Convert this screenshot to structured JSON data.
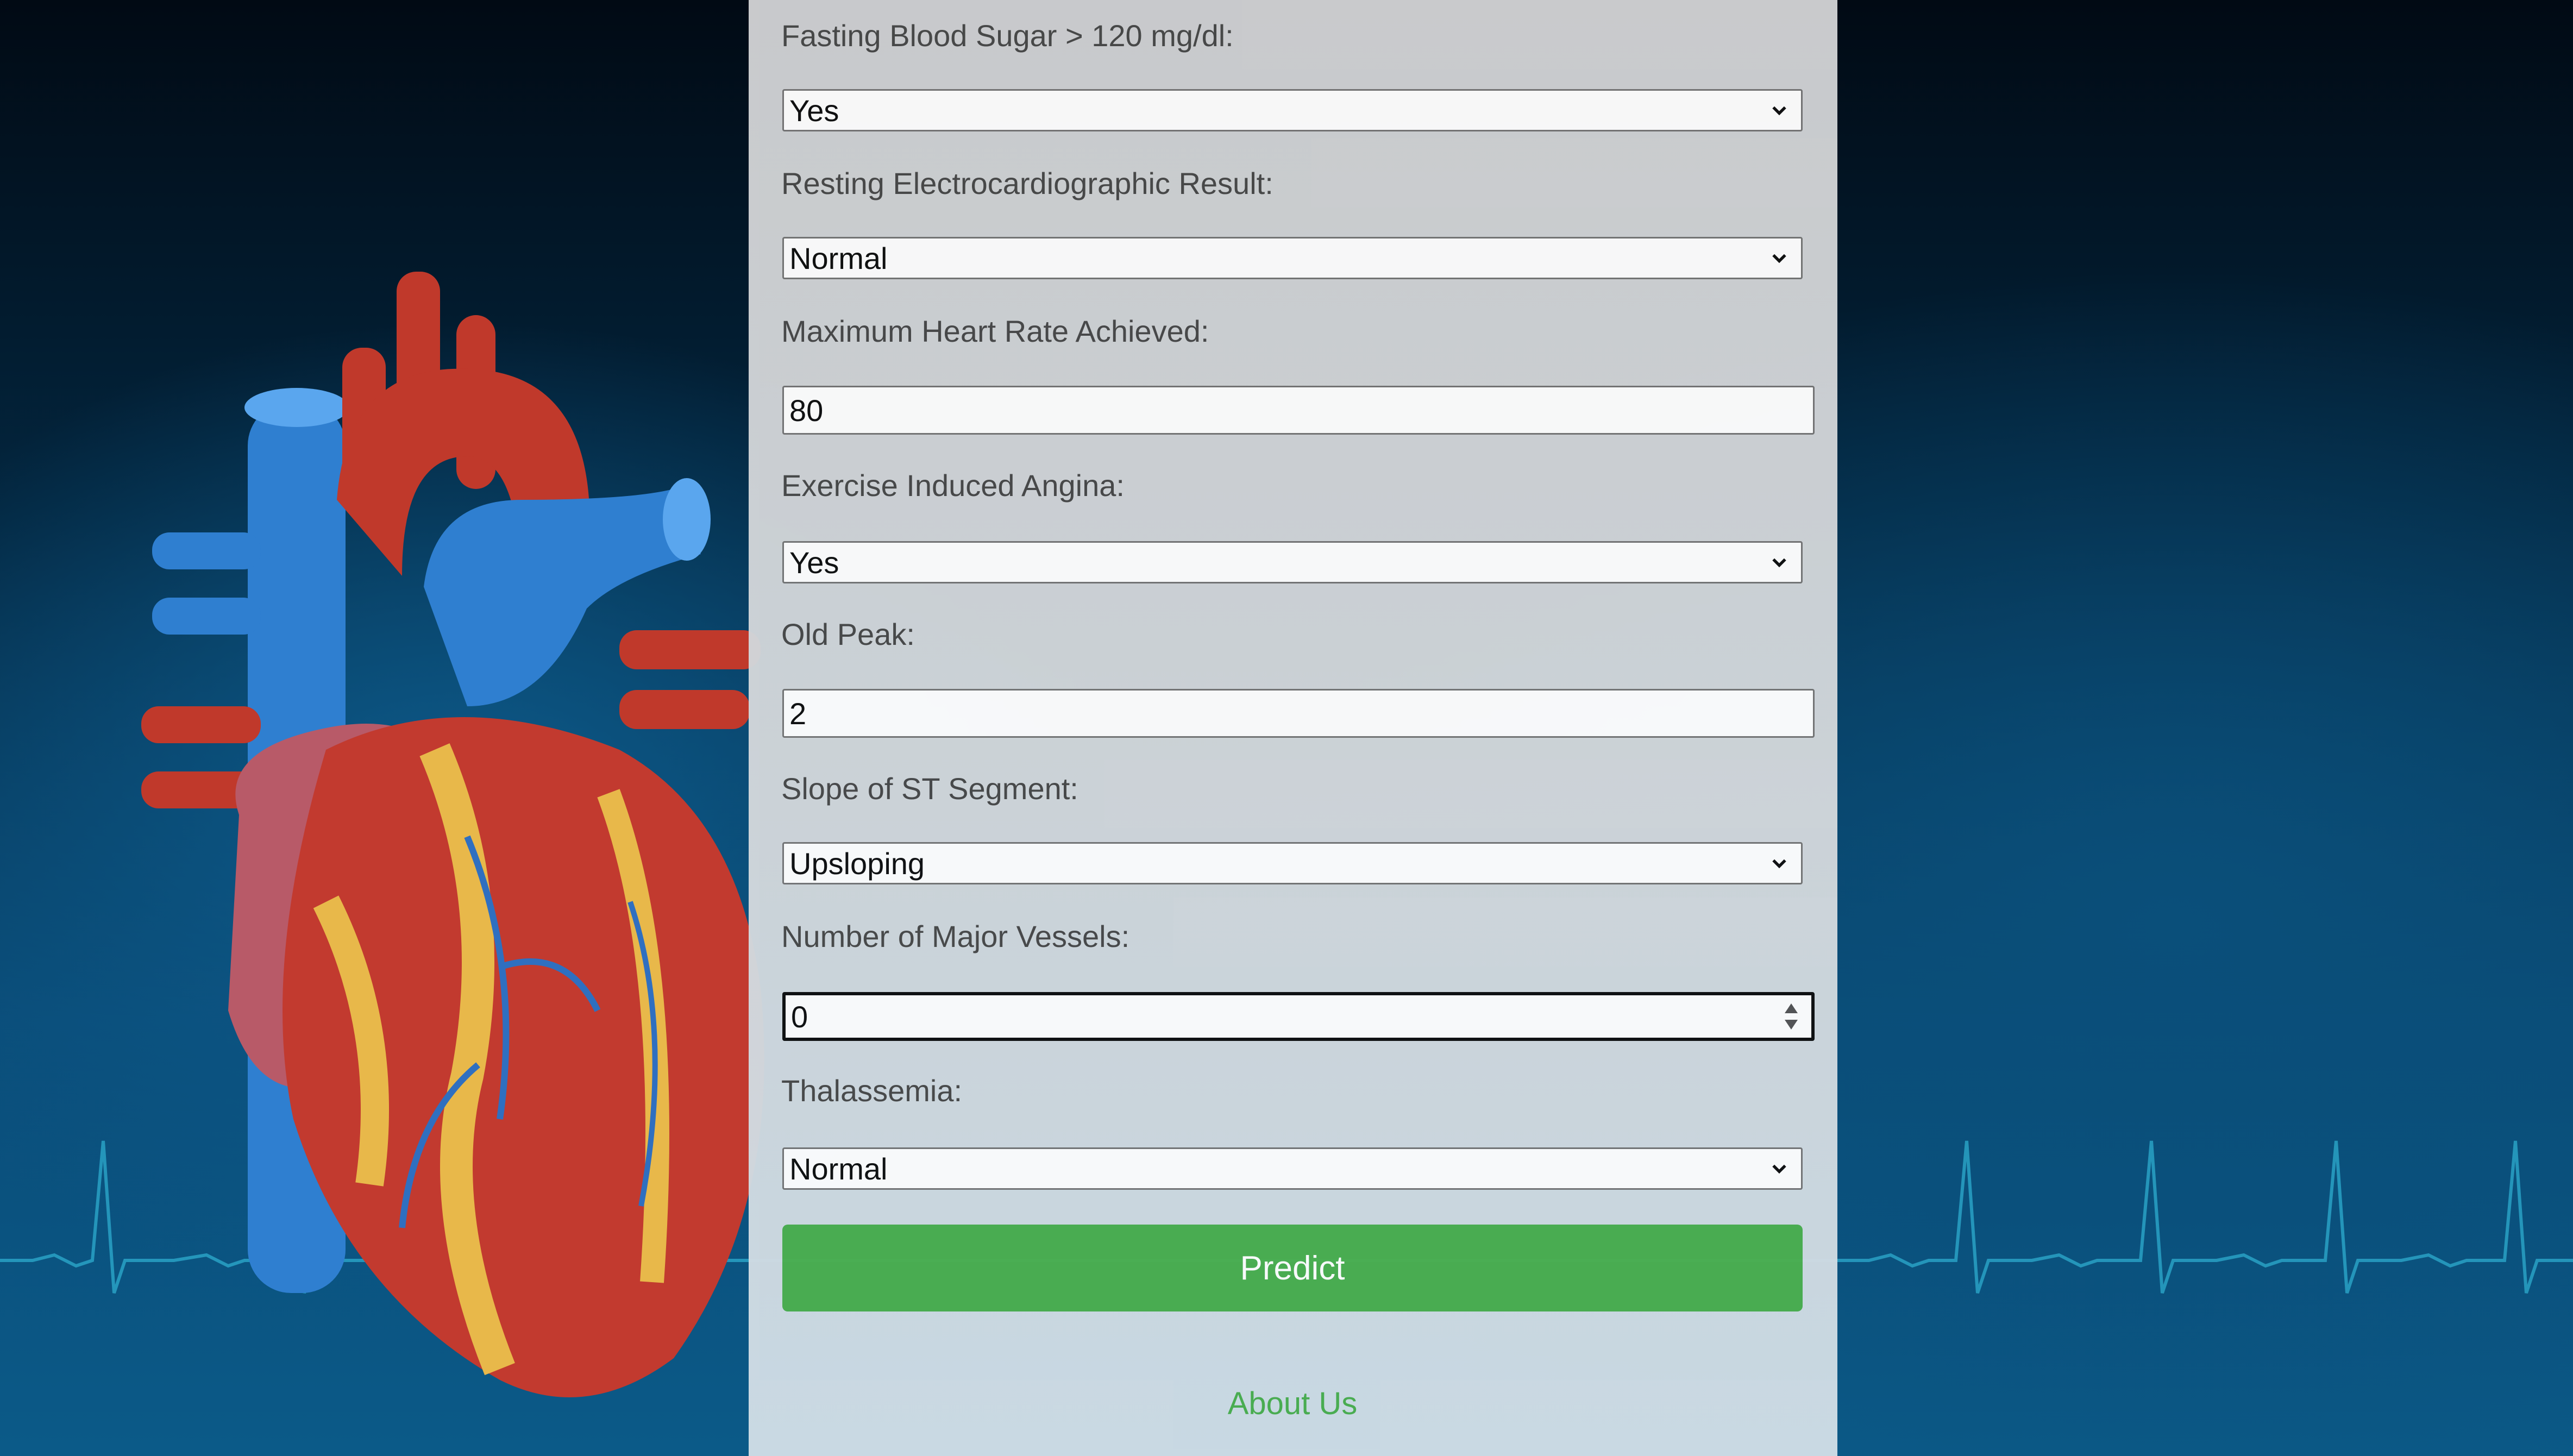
{
  "form": {
    "fbs": {
      "label": "Fasting Blood Sugar > 120 mg/dl:",
      "value": "Yes"
    },
    "restecg": {
      "label": "Resting Electrocardiographic Result:",
      "value": "Normal"
    },
    "thalach": {
      "label": "Maximum Heart Rate Achieved:",
      "value": "80"
    },
    "exang": {
      "label": "Exercise Induced Angina:",
      "value": "Yes"
    },
    "oldpeak": {
      "label": "Old Peak:",
      "value": "2"
    },
    "slope": {
      "label": "Slope of ST Segment:",
      "value": "Upsloping"
    },
    "ca": {
      "label": "Number of Major Vessels:",
      "value": "0"
    },
    "thal": {
      "label": "Thalassemia:",
      "value": "Normal"
    }
  },
  "actions": {
    "predict_label": "Predict",
    "about_label": "About Us"
  },
  "colors": {
    "accent": "#4caf50",
    "panel": "#d0d3d6",
    "background": "#0a4c78"
  },
  "icons": {
    "select_arrow": "chevron-down-icon",
    "number_spinner": "spinner-arrows-icon"
  }
}
